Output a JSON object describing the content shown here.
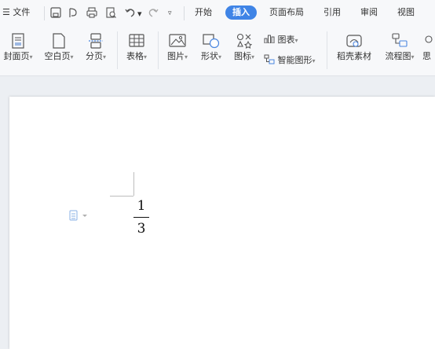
{
  "menu": {
    "file_label": "☰ 文件",
    "tabs": [
      "开始",
      "插入",
      "页面布局",
      "引用",
      "审阅",
      "视图"
    ],
    "active_tab": "插入"
  },
  "ribbon": {
    "cover_page": "封面页",
    "blank_page": "空白页",
    "page_break": "分页",
    "table": "表格",
    "picture": "图片",
    "shape": "形状",
    "icon": "图标",
    "chart": "图表",
    "smart_art": "智能图形",
    "template_material": "稻壳素材",
    "flowchart": "流程图",
    "mind_map_partial": "思"
  },
  "document": {
    "fraction_numerator": "1",
    "fraction_denominator": "3"
  },
  "colors": {
    "accent": "#3f84e6",
    "ribbon_bg": "#f7f8fa",
    "workspace_bg": "#eceff3"
  }
}
